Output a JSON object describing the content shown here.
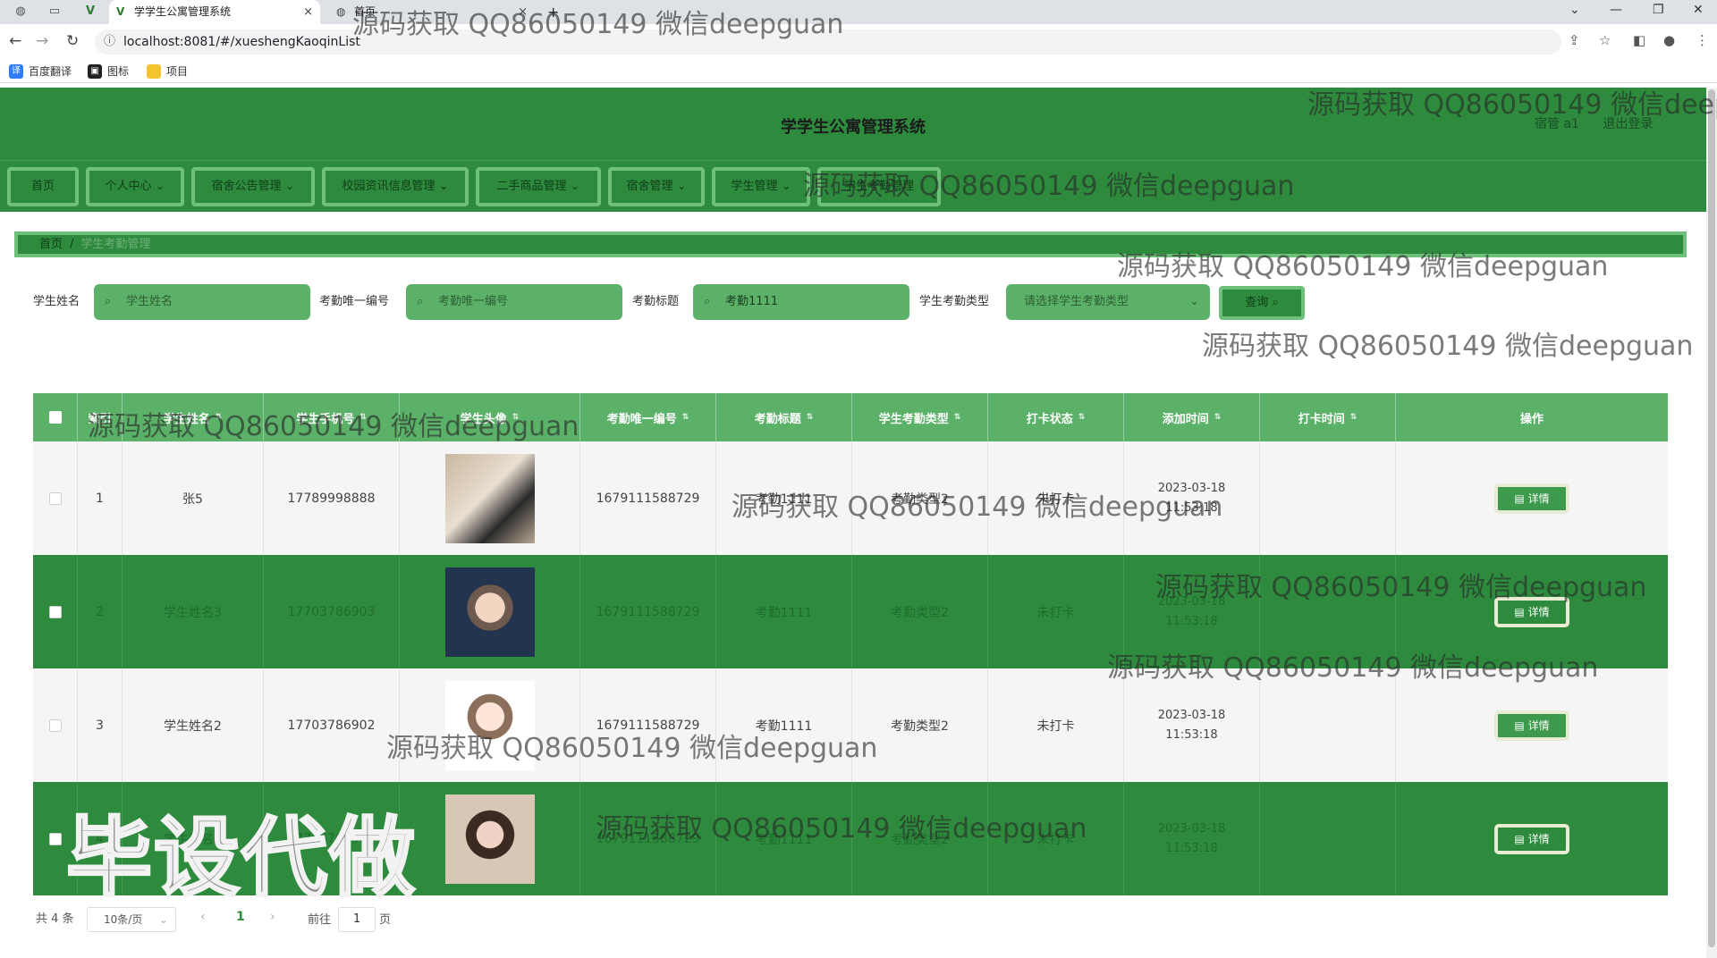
{
  "browser": {
    "tabs": [
      {
        "title": ""
      },
      {
        "title": "学学生公寓管理系统",
        "close": "×"
      },
      {
        "title": "首页",
        "close": "×"
      }
    ],
    "new_tab": "+",
    "url": "localhost:8081/#/xueshengKaoqinList",
    "bookmarks": [
      "百度翻译",
      "图标",
      "项目"
    ]
  },
  "app": {
    "title": "学学生公寓管理系统",
    "user": "宿管 a1",
    "logout": "退出登录"
  },
  "menu": [
    "首页",
    "个人中心",
    "宿舍公告管理",
    "校园资讯信息管理",
    "二手商品管理",
    "宿舍管理",
    "学生管理",
    "学生考勤管理"
  ],
  "breadcrumb": {
    "home": "首页",
    "sep": "/",
    "current": "学生考勤管理"
  },
  "search": {
    "student_name_label": "学生姓名",
    "student_name_placeholder": "学生姓名",
    "kaoqin_no_label": "考勤唯一编号",
    "kaoqin_no_placeholder": "考勤唯一编号",
    "kaoqin_title_label": "考勤标题",
    "kaoqin_title_value": "考勤1111",
    "kaoqin_type_label": "学生考勤类型",
    "kaoqin_type_placeholder": "请选择学生考勤类型",
    "query_button": "查询"
  },
  "table": {
    "headers": [
      "索引",
      "学生姓名",
      "学生手机号",
      "学生头像",
      "考勤唯一编号",
      "考勤标题",
      "学生考勤类型",
      "打卡状态",
      "添加时间",
      "打卡时间",
      "操作"
    ],
    "rows": [
      {
        "index": "1",
        "name": "张5",
        "phone": "17789998888",
        "kaoqin_no": "1679111588729",
        "title": "考勤1111",
        "type": "考勤类型2",
        "status": "未打卡",
        "added": "2023-03-18 11:53:18",
        "clock": "",
        "action": "详情"
      },
      {
        "index": "2",
        "name": "学生姓名3",
        "phone": "17703786903",
        "kaoqin_no": "1679111588729",
        "title": "考勤1111",
        "type": "考勤类型2",
        "status": "未打卡",
        "added": "2023-03-18 11:53:18",
        "clock": "",
        "action": "详情"
      },
      {
        "index": "3",
        "name": "学生姓名2",
        "phone": "17703786902",
        "kaoqin_no": "1679111588729",
        "title": "考勤1111",
        "type": "考勤类型2",
        "status": "未打卡",
        "added": "2023-03-18 11:53:18",
        "clock": "",
        "action": "详情"
      },
      {
        "index": "4",
        "name": "学生姓名1",
        "phone": "17703786901",
        "kaoqin_no": "1679111588729",
        "title": "考勤1111",
        "type": "考勤类型2",
        "status": "未打卡",
        "added": "2023-03-18 11:53:18",
        "clock": "",
        "action": "详情"
      }
    ]
  },
  "pager": {
    "total": "共 4 条",
    "size": "10条/页",
    "current": "1",
    "goto": "前往",
    "goto_value": "1",
    "page": "页"
  },
  "watermark": "源码获取 QQ86050149 微信deepguan",
  "big_watermark": "毕设代做",
  "colors": {
    "primary": "#2e8b3e",
    "light_green": "#5cb169",
    "border_green": "#6ec07b"
  }
}
